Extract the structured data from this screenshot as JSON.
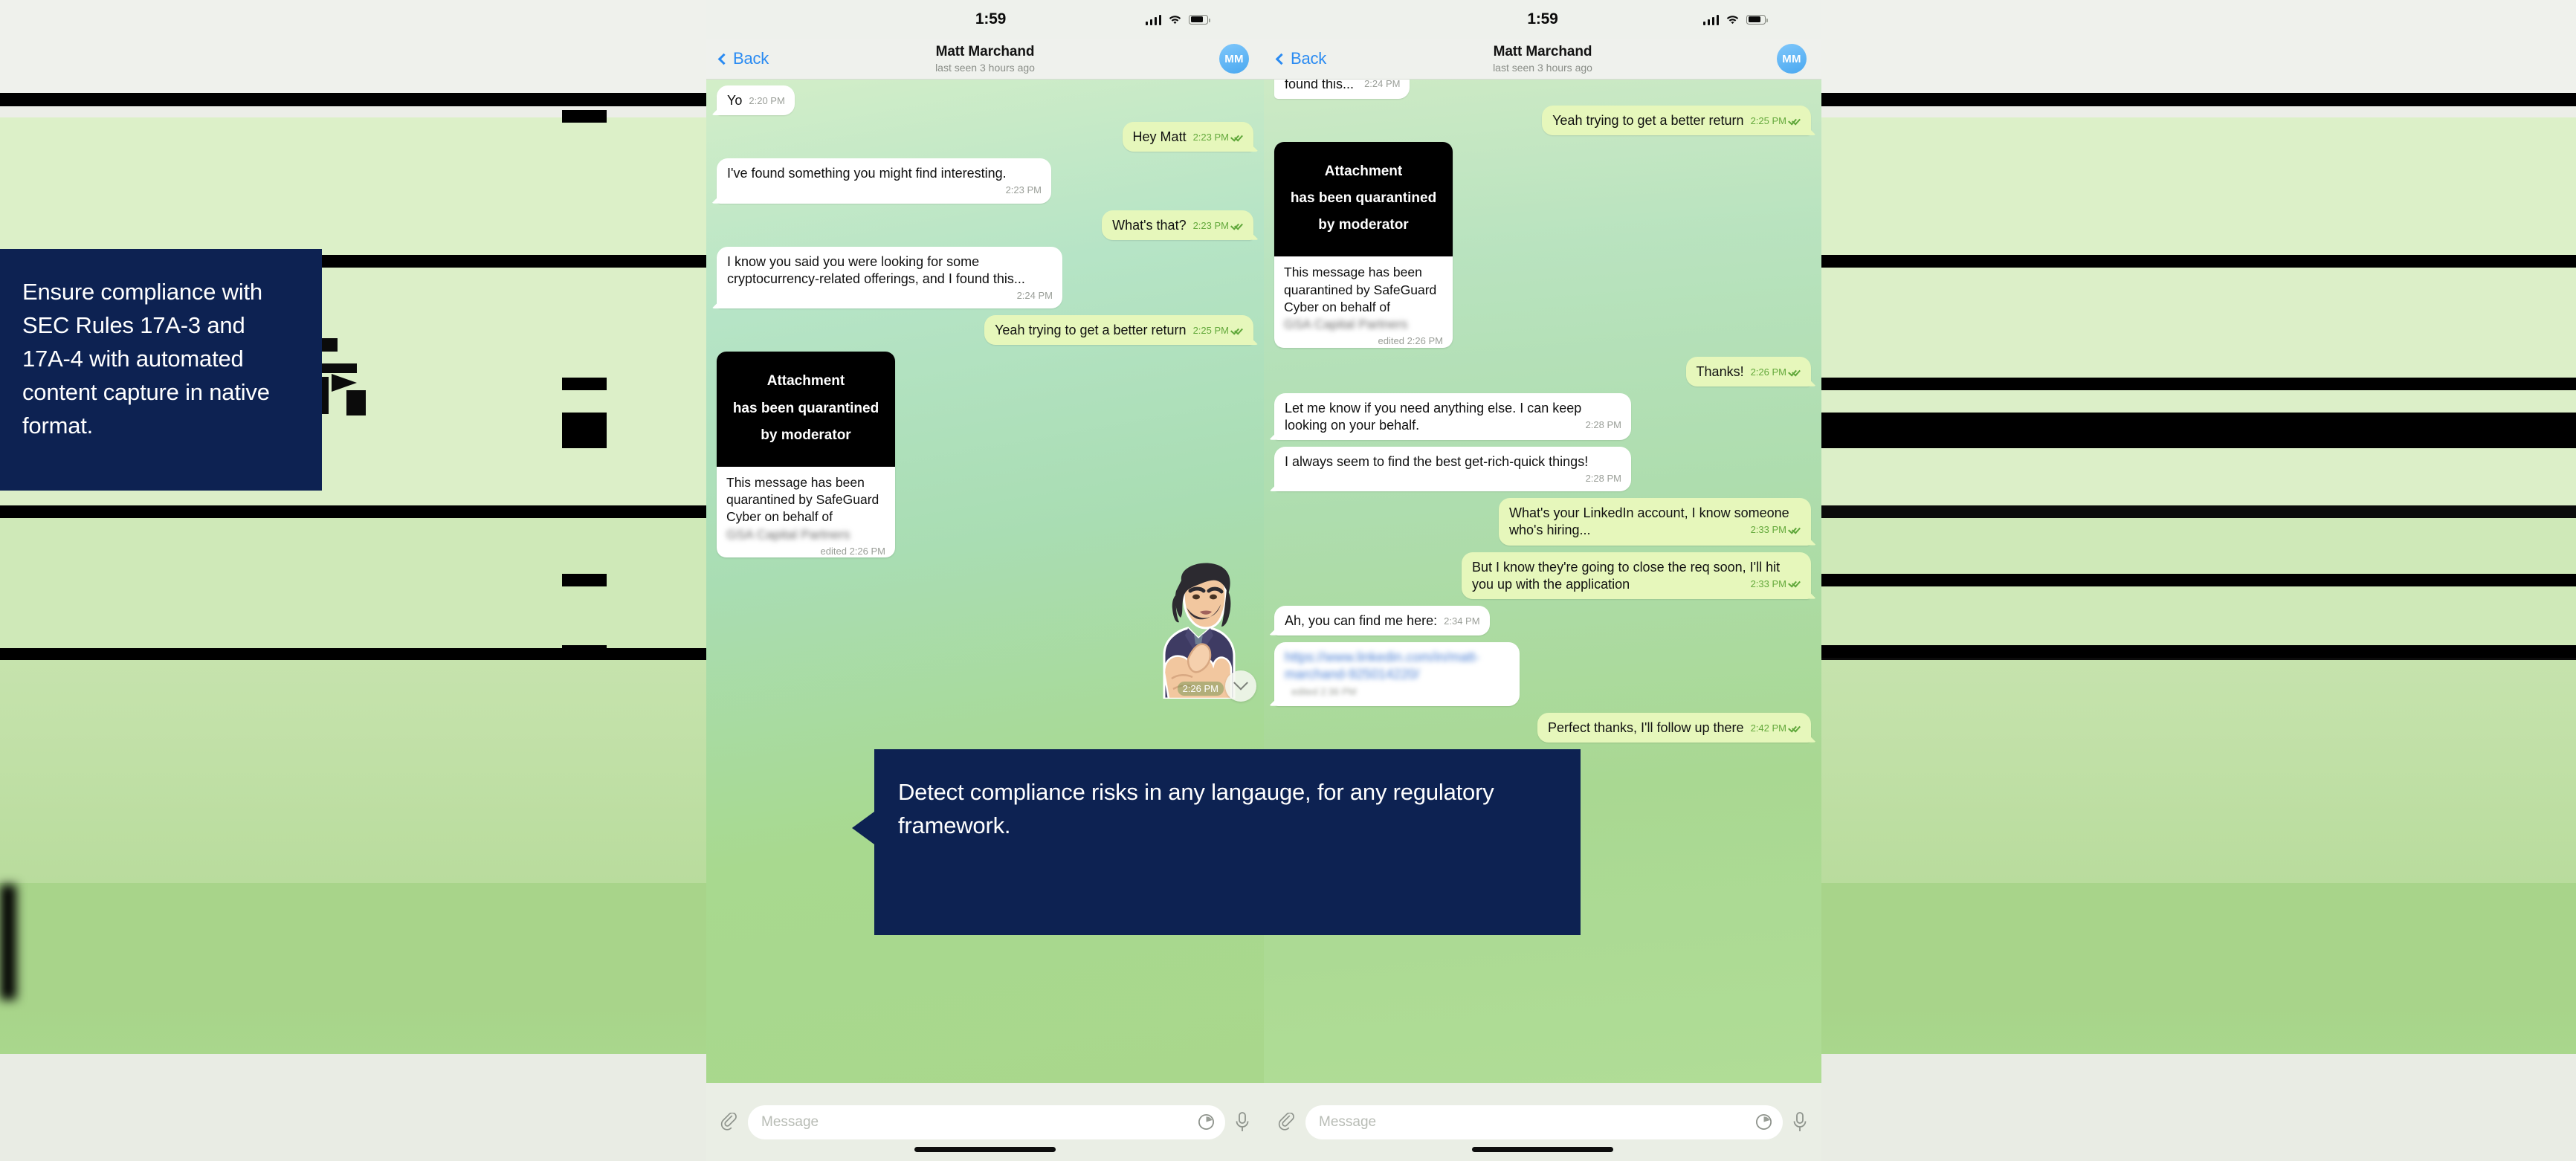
{
  "page": {
    "background_color": "#eef1ec",
    "accent_navy": "#0d2252",
    "chat_green_top": "#d3eec8",
    "chat_green_bottom": "#a9d78c",
    "out_bubble_color": "#e6f7bb",
    "in_bubble_color": "#ffffff",
    "link_blue": "#2a8bf2"
  },
  "callouts": [
    {
      "id": "sec-rules",
      "text": "Ensure compliance with SEC Rules 17A-3 and 17A-4 with automated content capture in native format."
    },
    {
      "id": "detect-risks",
      "text": "Detect compliance risks in any langauge, for any regulatory framework."
    }
  ],
  "phones": [
    {
      "id": "phone-left",
      "statusbar": {
        "time": "1:59",
        "icons": [
          "signal-icon",
          "wifi-icon",
          "battery-icon"
        ]
      },
      "navbar": {
        "back_label": "Back",
        "title": "Matt Marchand",
        "subtitle": "last seen 3 hours ago",
        "avatar_initials": "MM"
      },
      "messages": [
        {
          "type": "text",
          "dir": "in",
          "text": "Yo",
          "time": "2:20 PM",
          "inline": true
        },
        {
          "type": "text",
          "dir": "out",
          "text": "Hey Matt",
          "time": "2:23 PM",
          "inline": true,
          "ticks": true
        },
        {
          "type": "text",
          "dir": "in",
          "text": "I've found something you might find interesting.",
          "time": "2:23 PM",
          "inline": false
        },
        {
          "type": "text",
          "dir": "out",
          "text": "What's that?",
          "time": "2:23 PM",
          "inline": true,
          "ticks": true
        },
        {
          "type": "text",
          "dir": "in",
          "text": "I know you said you were looking for some cryptocurrency-related offerings, and I found this...",
          "time": "2:24 PM",
          "inline": false
        },
        {
          "type": "text",
          "dir": "out",
          "text": "Yeah trying to get a better return",
          "time": "2:25 PM",
          "inline": true,
          "ticks": true
        },
        {
          "type": "quarantine",
          "dir": "in",
          "image_lines": [
            "Attachment",
            "has been quarantined",
            "by moderator"
          ],
          "body": "This message has been quarantined by SafeGuard Cyber on behalf of",
          "body_redacted": "GSA Capital Partners",
          "edited_label": "edited 2:26 PM"
        },
        {
          "type": "sticker",
          "dir": "in",
          "name": "thumbs-up-sticker",
          "time": "2:26 PM"
        }
      ],
      "input": {
        "placeholder": "Message",
        "attach_icon": "paperclip-icon",
        "schedule_icon": "clock-icon",
        "voice_icon": "microphone-icon"
      },
      "scroll_down_icon": "chevron-down-icon"
    },
    {
      "id": "phone-right",
      "statusbar": {
        "time": "1:59",
        "icons": [
          "signal-icon",
          "wifi-icon",
          "battery-icon"
        ]
      },
      "navbar": {
        "back_label": "Back",
        "title": "Matt Marchand",
        "subtitle": "last seen 3 hours ago",
        "avatar_initials": "MM"
      },
      "messages": [
        {
          "type": "text",
          "dir": "in",
          "text": "found this...",
          "time": "2:24 PM",
          "inline": false,
          "clipped": true
        },
        {
          "type": "text",
          "dir": "out",
          "text": "Yeah trying to get a better return",
          "time": "2:25 PM",
          "inline": true,
          "ticks": true
        },
        {
          "type": "quarantine",
          "dir": "in",
          "image_lines": [
            "Attachment",
            "has been quarantined",
            "by moderator"
          ],
          "body": "This message has been quarantined by SafeGuard Cyber on behalf of",
          "body_redacted": "GSA Capital Partners",
          "edited_label": "edited 2:26 PM"
        },
        {
          "type": "text",
          "dir": "out",
          "text": "Thanks!",
          "time": "2:26 PM",
          "inline": true,
          "ticks": true
        },
        {
          "type": "text",
          "dir": "in",
          "text": "Let me know if you need anything else.  I can keep looking on your behalf.",
          "time": "2:28 PM",
          "inline": false
        },
        {
          "type": "text",
          "dir": "in",
          "text": "I always seem to find the best get-rich-quick things!",
          "time": "2:28 PM",
          "inline": false
        },
        {
          "type": "text",
          "dir": "out",
          "text": "What's your LinkedIn account, I know someone who's hiring...",
          "time": "2:33 PM",
          "inline": false,
          "ticks": true
        },
        {
          "type": "text",
          "dir": "out",
          "text": "But I know they're going to close the req soon, I'll hit you up with the application",
          "time": "2:33 PM",
          "inline": false,
          "ticks": true
        },
        {
          "type": "text",
          "dir": "in",
          "text": "Ah, you can find me here:",
          "time": "2:34 PM",
          "inline": true
        },
        {
          "type": "link",
          "dir": "in",
          "text": "https://www.linkedin.com/in/matt-marchand-925014220/",
          "time": "edited 2:36 PM"
        },
        {
          "type": "text",
          "dir": "out",
          "text": "Perfect thanks, I'll follow up there",
          "time": "2:42 PM",
          "inline": true,
          "ticks": true
        }
      ],
      "input": {
        "placeholder": "Message",
        "attach_icon": "paperclip-icon",
        "schedule_icon": "clock-icon",
        "voice_icon": "microphone-icon"
      }
    }
  ]
}
